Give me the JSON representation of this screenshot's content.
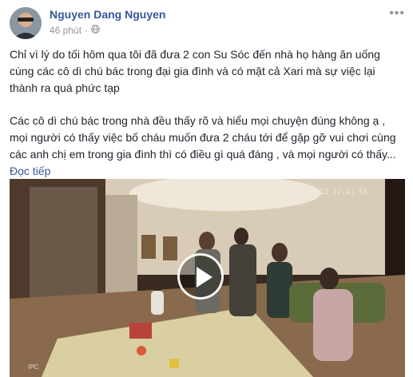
{
  "post": {
    "author": "Nguyen Dang Nguyen",
    "time": "46 phút",
    "audience_icon": "globe-icon",
    "more_icon": "more-options-icon",
    "paragraph1": "Chỉ vì lý do tối hôm qua tôi đã đưa 2 con Su Sóc đến nhà họ hàng ăn uống cùng các cô dì chú bác trong đại gia đình và có mặt cả Xari mà sự việc lại thành ra quá phức tạp",
    "paragraph2": "Các cô dì chú bác trong nhà đều thấy rõ và hiểu mọi chuyện đúng không ạ , mọi người có thấy việc bố cháu muốn đưa 2 cháu tới để gặp gỡ vui chơi cùng các anh chị em trong gia đình thì có điều gì quá đáng , và mọi người có thấy...",
    "read_more": "Đọc tiếp"
  },
  "video": {
    "timestamp": "2018-05-12 22:41:55",
    "watermark": "IPC",
    "play_icon": "play-icon"
  },
  "colors": {
    "author": "#365899",
    "meta": "#90949c",
    "link": "#385898",
    "text": "#1d2129"
  }
}
